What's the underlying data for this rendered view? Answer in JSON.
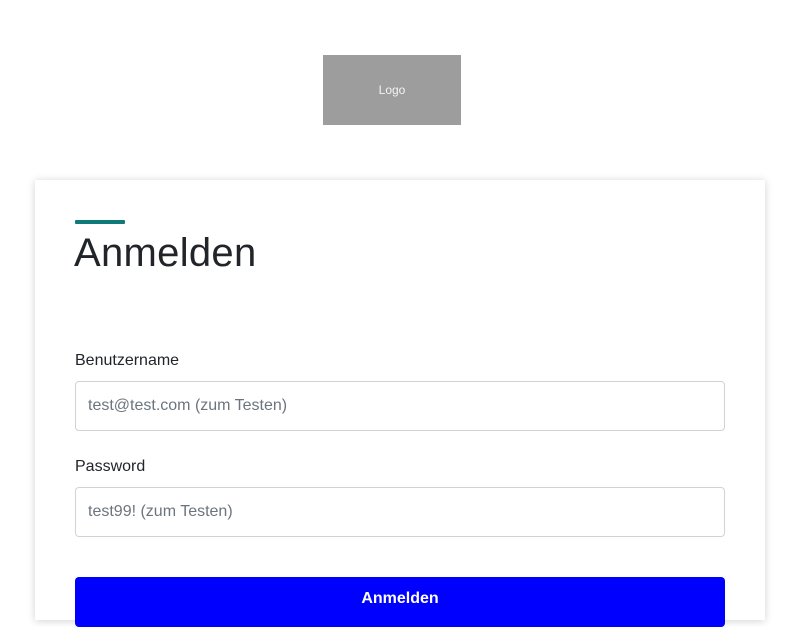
{
  "logo": {
    "text": "Logo"
  },
  "login": {
    "title": "Anmelden",
    "accent_color": "#0e7a7a",
    "username": {
      "label": "Benutzername",
      "placeholder": "test@test.com (zum Testen)",
      "value": ""
    },
    "password": {
      "label": "Password",
      "placeholder": "test99! (zum Testen)",
      "value": ""
    },
    "submit_label": "Anmelden",
    "submit_color": "#0000ff"
  }
}
